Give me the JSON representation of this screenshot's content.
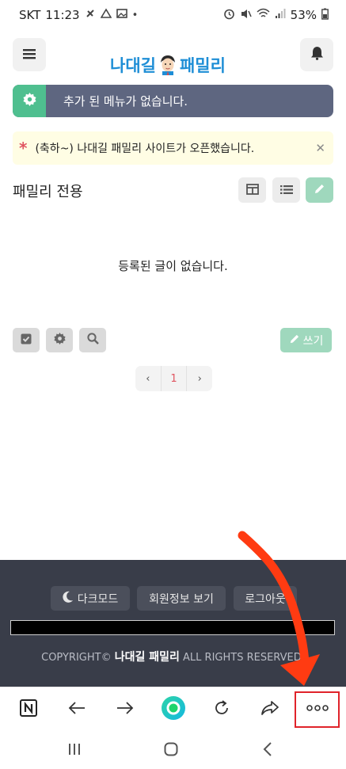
{
  "status_bar": {
    "carrier": "SKT",
    "time": "11:23",
    "battery": "53%",
    "icons_left": [
      "settings-icon",
      "drive-icon",
      "image-icon",
      "dot-icon"
    ],
    "icons_right": [
      "alarm-icon",
      "mute-icon",
      "wifi-icon",
      "signal-icon",
      "battery-icon"
    ]
  },
  "header": {
    "logo_text_1": "나대길",
    "logo_text_2": "패밀리",
    "menu_icon": "hamburger-icon",
    "notification_icon": "bell-icon"
  },
  "menu_notice": {
    "text": "추가 된 메뉴가 없습니다.",
    "icon": "gear-icon"
  },
  "announcement": {
    "star": "*",
    "text": "(축하~) 나대길 패밀리 사이트가 오픈했습니다.",
    "close_icon": "close-icon"
  },
  "board": {
    "title": "패밀리 전용",
    "empty_message": "등록된 글이 없습니다.",
    "view_buttons": [
      "grid-view-icon",
      "list-view-icon",
      "pencil-icon"
    ],
    "tool_buttons": [
      "checkbox-icon",
      "gear-icon",
      "search-icon"
    ],
    "write_label": "쓰기"
  },
  "pagination": {
    "prev": "‹",
    "current": "1",
    "next": "›"
  },
  "footer": {
    "dark_mode_label": "다크모드",
    "member_info_label": "회원정보 보기",
    "login_label": "로그아웃",
    "copyright_prefix": "COPYRIGHT©",
    "copyright_brand": "나대길 패밀리",
    "copyright_suffix": "ALL RIGHTS RESERVED."
  },
  "browser_toolbar": {
    "items": [
      "naver-icon",
      "back-icon",
      "forward-icon",
      "home-circle-icon",
      "refresh-icon",
      "share-icon",
      "more-icon"
    ]
  },
  "nav_bar": {
    "items": [
      "recent-apps-icon",
      "home-icon",
      "back-nav-icon"
    ]
  },
  "colors": {
    "accent_green": "#4fbf8f",
    "notice_bg": "#5e6680",
    "footer_bg": "#393d49",
    "highlight_red": "#e0232a",
    "logo_blue": "#1e8ed6"
  }
}
